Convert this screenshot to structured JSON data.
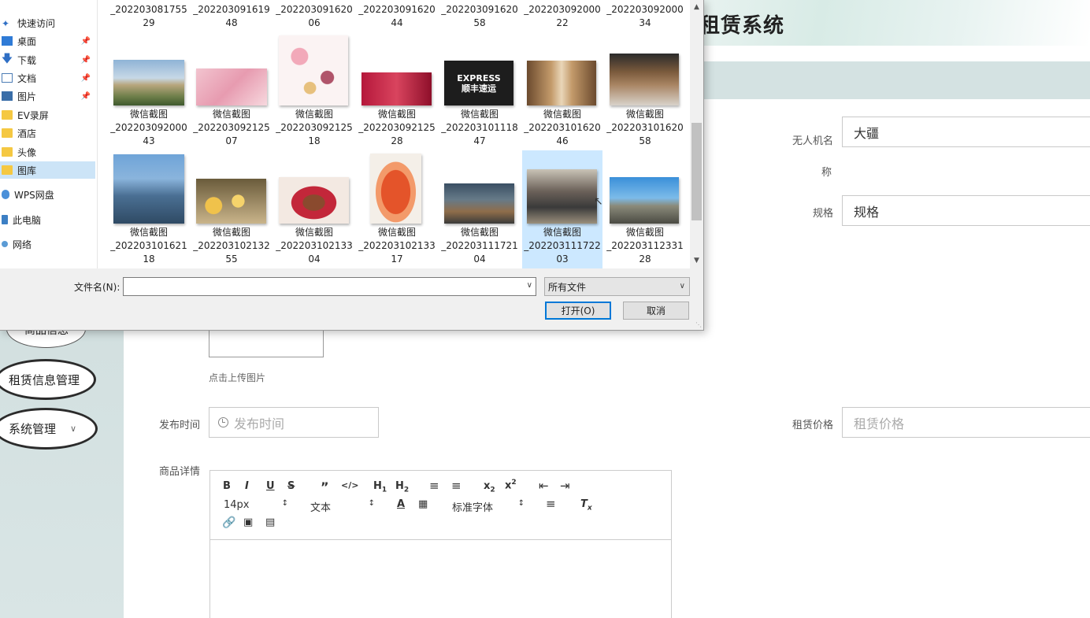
{
  "app": {
    "title": "租赁系统",
    "sidebar": [
      {
        "label": "商品信息"
      },
      {
        "label": "租赁信息管理"
      },
      {
        "label": "系统管理",
        "chevron": "chevron-down-icon"
      }
    ],
    "form": {
      "drone_name_label_1": "无人机名",
      "drone_name_label_2": "称",
      "drone_name_value": "大疆",
      "spec_label": "规格",
      "spec_value": "规格",
      "upload_hint": "点击上传图片",
      "publish_time_label": "发布时间",
      "publish_time_placeholder": "发布时间",
      "rent_price_label": "租赁价格",
      "rent_price_placeholder": "租赁价格",
      "detail_label": "商品详情"
    },
    "editor": {
      "font_size": "14px",
      "text_type": "文本",
      "font_family": "标准字体"
    }
  },
  "dialog": {
    "nav": [
      {
        "label": "快速访问",
        "icon": "star-icon"
      },
      {
        "label": "桌面",
        "icon": "desktop-icon",
        "pinned": true
      },
      {
        "label": "下载",
        "icon": "download-icon",
        "pinned": true
      },
      {
        "label": "文档",
        "icon": "document-icon",
        "pinned": true
      },
      {
        "label": "图片",
        "icon": "pictures-icon",
        "pinned": true
      },
      {
        "label": "EV录屏",
        "icon": "folder-icon"
      },
      {
        "label": "酒店",
        "icon": "folder-icon"
      },
      {
        "label": "头像",
        "icon": "folder-icon"
      },
      {
        "label": "图库",
        "icon": "folder-icon",
        "selected": true
      },
      {
        "label": "WPS网盘",
        "icon": "cloud-icon"
      },
      {
        "label": "此电脑",
        "icon": "computer-icon"
      },
      {
        "label": "网络",
        "icon": "network-icon"
      }
    ],
    "row0": [
      {
        "l1": "_202203081755",
        "l2": "29"
      },
      {
        "l1": "_202203091619",
        "l2": "48"
      },
      {
        "l1": "_202203091620",
        "l2": "06"
      },
      {
        "l1": "_202203091620",
        "l2": "44"
      },
      {
        "l1": "_202203091620",
        "l2": "58"
      },
      {
        "l1": "_202203092000",
        "l2": "22"
      },
      {
        "l1": "_202203092000",
        "l2": "34"
      }
    ],
    "row1": [
      {
        "l0": "微信截图",
        "l1": "_202203092000",
        "l2": "43"
      },
      {
        "l0": "微信截图",
        "l1": "_202203092125",
        "l2": "07"
      },
      {
        "l0": "微信截图",
        "l1": "_202203092125",
        "l2": "18"
      },
      {
        "l0": "微信截图",
        "l1": "_202203092125",
        "l2": "28"
      },
      {
        "l0": "微信截图",
        "l1": "_202203101118",
        "l2": "47"
      },
      {
        "l0": "微信截图",
        "l1": "_202203101620",
        "l2": "46"
      },
      {
        "l0": "微信截图",
        "l1": "_202203101620",
        "l2": "58"
      }
    ],
    "row2": [
      {
        "l0": "微信截图",
        "l1": "_202203101621",
        "l2": "18"
      },
      {
        "l0": "微信截图",
        "l1": "_202203102132",
        "l2": "55"
      },
      {
        "l0": "微信截图",
        "l1": "_202203102133",
        "l2": "04"
      },
      {
        "l0": "微信截图",
        "l1": "_202203102133",
        "l2": "17"
      },
      {
        "l0": "微信截图",
        "l1": "_202203111721",
        "l2": "04"
      },
      {
        "l0": "微信截图",
        "l1": "_202203111722",
        "l2": "03",
        "selected": true
      },
      {
        "l0": "微信截图",
        "l1": "_202203112331",
        "l2": "28"
      }
    ],
    "thumb_text": "EXPRESS 顺丰速运",
    "filename_label": "文件名(N):",
    "filename_value": "",
    "filetype": "所有文件",
    "open_button": "打开(O)",
    "cancel_button": "取消"
  }
}
